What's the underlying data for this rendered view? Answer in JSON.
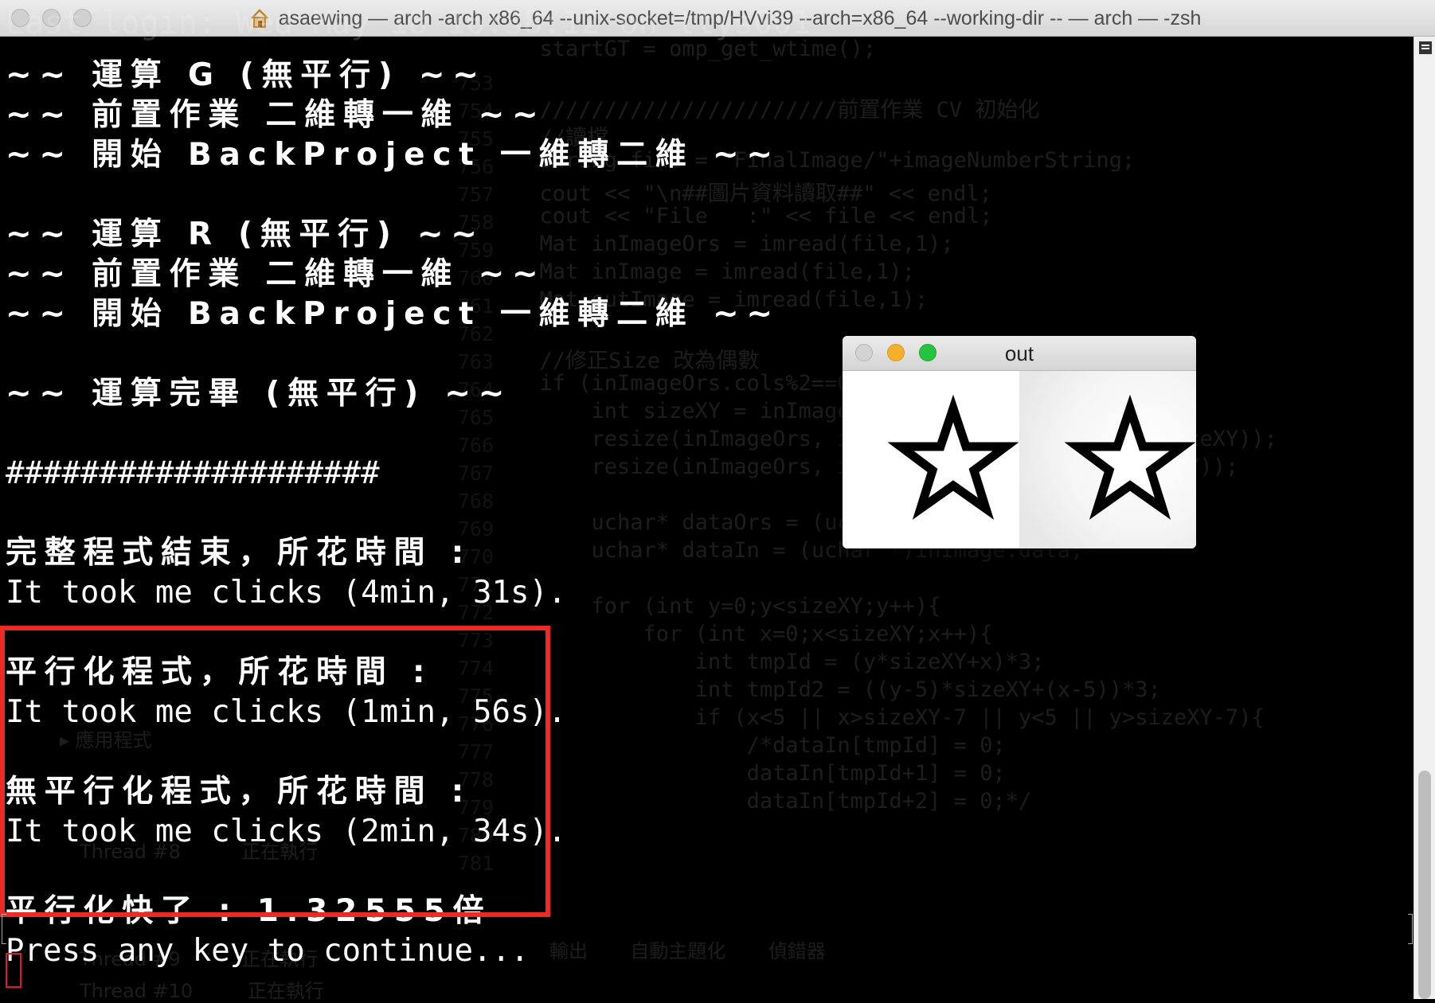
{
  "window": {
    "title": "asaewing — arch -arch x86_64  --unix-socket=/tmp/HVvi39 --arch=x86_64 --working-dir   -- — arch — -zsh"
  },
  "terminal": {
    "lines": [
      "~~ 運算 G (無平行) ~~",
      "~~ 前置作業 二維轉一維 ~~",
      "~~ 開始 BackProject 一維轉二維 ~~",
      "",
      "~~ 運算 R (無平行) ~~",
      "~~ 前置作業 二維轉一維 ~~",
      "~~ 開始 BackProject 一維轉二維 ~~",
      "",
      "~~ 運算完畢 (無平行) ~~",
      "",
      "####################",
      "",
      "完整程式結束，所花時間 :",
      "It took me clicks (4min, 31s).",
      "",
      "平行化程式，所花時間 :",
      "It took me clicks (1min, 56s).",
      "",
      "無平行化程式，所花時間 :",
      "It took me clicks (2min, 34s).",
      "",
      "平行化快了 : 1.32555倍",
      "Press any key to continue..."
    ]
  },
  "out_window": {
    "title": "out"
  },
  "icons": [
    "home-icon",
    "star-icon",
    "scroll-menu-icon"
  ],
  "colors": {
    "highlight_box": "#ee2a24",
    "cursor": "#e0182a",
    "close": "#d0d0d0",
    "minimize": "#f5b02a",
    "zoom": "#26c33f"
  }
}
